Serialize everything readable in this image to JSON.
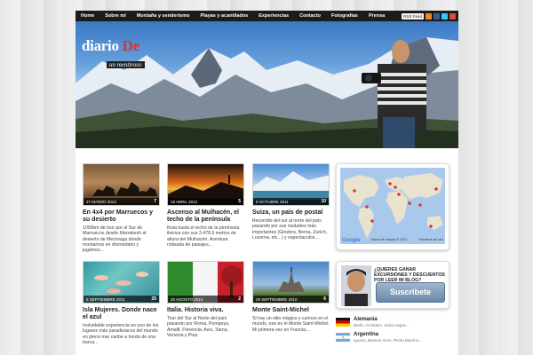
{
  "nav": {
    "items": [
      "Home",
      "Sobre mí",
      "Montaña y senderismo",
      "Playas y acantilados",
      "Experiencias",
      "Contacto",
      "Fotografías",
      "Prensa"
    ],
    "rss": "RSS Feed"
  },
  "header": {
    "brand_main": "diario ",
    "brand_accent": "De",
    "brand_sub": "un mentiroso"
  },
  "posts": [
    {
      "date": "27 MARZO 2013",
      "count": "7",
      "title": "En 4x4 por Marruecos y su desierto",
      "excerpt": "1000km de tour por el Sur de Marruecos desde Marrakesh al desierto de Merzouga donde montamos en dromedario y jugamos..."
    },
    {
      "date": "19 ABRIL 2012",
      "count": "5",
      "title": "Ascenso al Mulhacén, el techo de la península",
      "excerpt": "Ruta hasta el techo de la península ibérica con sus 3.478,6 metros de altura del Mulhacén. Aventura rodeada de paisajes..."
    },
    {
      "date": "9 OCTUBRE 2011",
      "count": "10",
      "title": "Suiza, un país de postal",
      "excerpt": "Recorrido del sur al norte del país pasando por sus ciudades más importantes (Ginebra, Berna, Zurich, Lucerna, etc...) y espectaculos..."
    },
    {
      "date": "5 SEPTIEMBRE 2011",
      "count": "25",
      "title": "Isla Mujeres. Donde nace el azul",
      "excerpt": "Inolvidable experiencia en uno de los lugares más paradisíacos del mundo en pleno mar caribe a bordo de una barca..."
    },
    {
      "date": "20 AGOSTO 2010",
      "count": "2",
      "title": "Italia. Historia viva.",
      "excerpt": "Tour del Sur al Norte del país pasando por Roma, Pompeya, Amalfi, Florencia, Asís, Siena, Venecia y Pisa."
    },
    {
      "date": "29 SEPTIEMBRE 2010",
      "count": "6",
      "title": "Monte Saint-Michel",
      "excerpt": "Si hay un sitio mágico y curioso en el mundo, ese es el Monte Saint-Michel. Mi primera vez en Francia,..."
    }
  ],
  "map": {
    "google": "Google",
    "attribution": "Datos de mapas © 2017",
    "terms": "Términos de uso"
  },
  "promo": {
    "title": "¿QUIERES GANAR EXCURSIONES Y DESCUENTOS POR LEER MI BLOG?",
    "button": "Suscribete"
  },
  "countries": [
    {
      "name": "Alemania",
      "desc": "Berlín, Postdam. Selva negra..."
    },
    {
      "name": "Argentina",
      "desc": "Iguazú, Buenos Aires, Perito Moreno..."
    }
  ],
  "colors": {
    "nav_bg": "#1b1b1b",
    "accent_red": "#d8352a",
    "subscribe_bg": "#7f9aba"
  }
}
